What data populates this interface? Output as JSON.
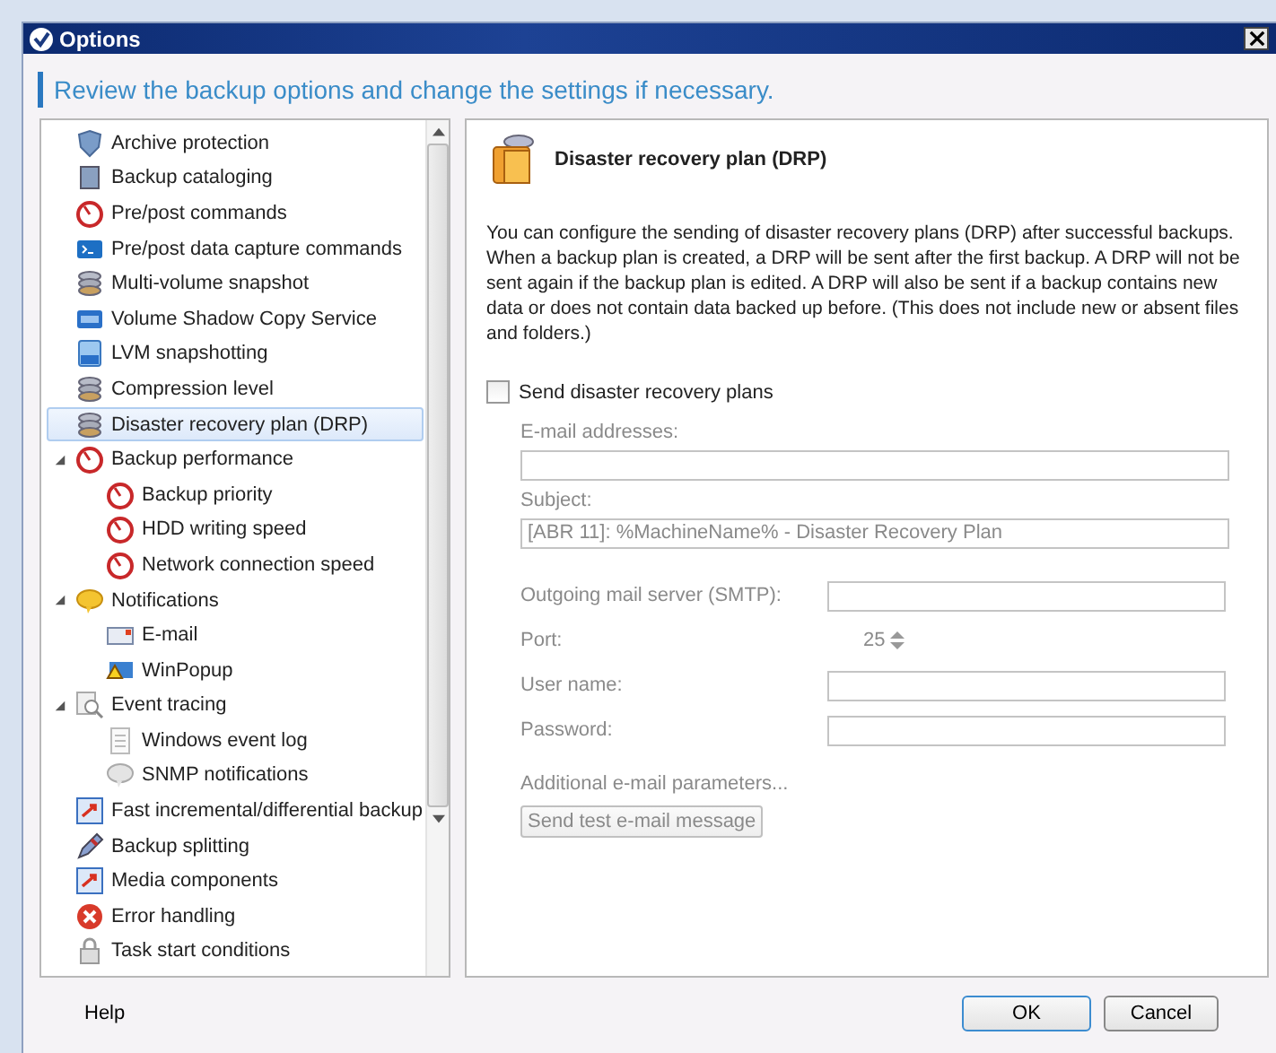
{
  "window": {
    "title": "Options"
  },
  "instruction": "Review the backup options and change the settings if necessary.",
  "tree": [
    {
      "label": "Archive protection",
      "selected": false
    },
    {
      "label": "Backup cataloging",
      "selected": false
    },
    {
      "label": "Pre/post commands",
      "selected": false
    },
    {
      "label": "Pre/post data capture commands",
      "selected": false
    },
    {
      "label": "Multi-volume snapshot",
      "selected": false
    },
    {
      "label": "Volume Shadow Copy Service",
      "selected": false
    },
    {
      "label": "LVM snapshotting",
      "selected": false
    },
    {
      "label": "Compression level",
      "selected": false
    },
    {
      "label": "Disaster recovery plan (DRP)",
      "selected": true
    },
    {
      "label": "Backup performance",
      "selected": false,
      "expanded": true,
      "children": [
        {
          "label": "Backup priority",
          "selected": false
        },
        {
          "label": "HDD writing speed",
          "selected": false
        },
        {
          "label": "Network connection speed",
          "selected": false
        }
      ]
    },
    {
      "label": "Notifications",
      "selected": false,
      "expanded": true,
      "children": [
        {
          "label": "E-mail",
          "selected": false
        },
        {
          "label": "WinPopup",
          "selected": false
        }
      ]
    },
    {
      "label": "Event tracing",
      "selected": false,
      "expanded": true,
      "children": [
        {
          "label": "Windows event log",
          "selected": false
        },
        {
          "label": "SNMP notifications",
          "selected": false
        }
      ]
    },
    {
      "label": "Fast incremental/differential backup",
      "selected": false
    },
    {
      "label": "Backup splitting",
      "selected": false
    },
    {
      "label": "Media components",
      "selected": false
    },
    {
      "label": "Error handling",
      "selected": false
    },
    {
      "label": "Task start conditions",
      "selected": false
    }
  ],
  "detail": {
    "title": "Disaster recovery plan (DRP)",
    "description": "You can configure the sending of disaster recovery plans (DRP) after successful backups. When a backup plan is created, a DRP will be sent after the first backup. A DRP will not be sent again if the backup plan is edited. A DRP will also be sent if a backup contains new data or does not contain data backed up before. (This does not include new or absent files and folders.)",
    "send_checkbox": {
      "label": "Send disaster recovery plans",
      "checked": false
    },
    "fields": [
      {
        "kind": "stacked",
        "label": "E-mail addresses:"
      },
      {
        "kind": "stacked",
        "label": "Subject:",
        "value": "[ABR 11]: %MachineName% - Disaster Recovery Plan"
      },
      {
        "kind": "inline",
        "label": "Outgoing mail server (SMTP):"
      },
      {
        "kind": "spinner",
        "label": "Port:",
        "value": "25"
      },
      {
        "kind": "inline",
        "label": "User name:"
      },
      {
        "kind": "inline",
        "label": "Password:"
      }
    ],
    "link": "Additional e-mail parameters...",
    "test_button": "Send test e-mail message"
  },
  "buttons": {
    "help": "Help",
    "ok": "OK",
    "cancel": "Cancel"
  }
}
